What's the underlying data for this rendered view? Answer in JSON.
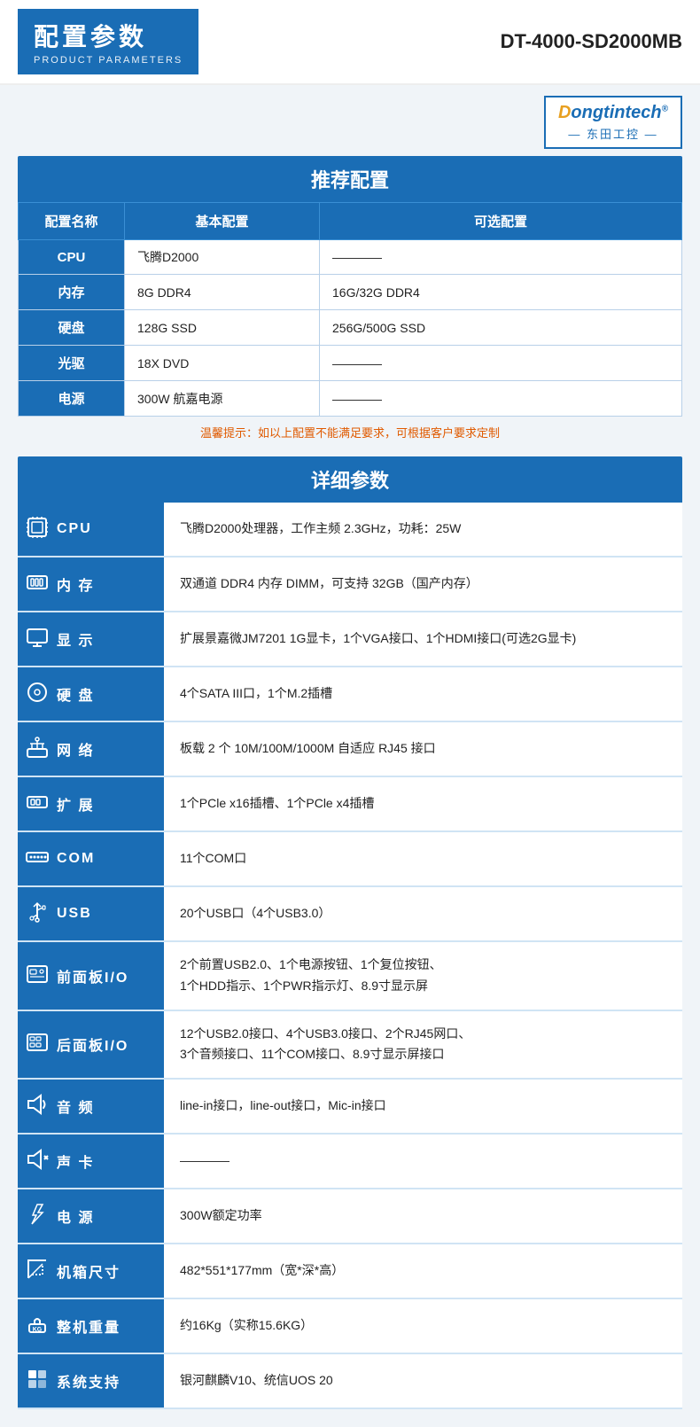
{
  "header": {
    "title_cn": "配置参数",
    "title_en": "PRODUCT PARAMETERS",
    "product_id": "DT-4000-SD2000MB"
  },
  "logo": {
    "brand_d": "D",
    "brand_rest": "ongtintech",
    "registered": "®",
    "sub": "— 东田工控 —"
  },
  "recommended": {
    "section_title": "推荐配置",
    "col_name": "配置名称",
    "col_basic": "基本配置",
    "col_optional": "可选配置",
    "rows": [
      {
        "label": "CPU",
        "basic": "飞腾D2000",
        "optional": "————"
      },
      {
        "label": "内存",
        "basic": "8G DDR4",
        "optional": "16G/32G DDR4"
      },
      {
        "label": "硬盘",
        "basic": "128G SSD",
        "optional": "256G/500G SSD"
      },
      {
        "label": "光驱",
        "basic": "18X DVD",
        "optional": "————"
      },
      {
        "label": "电源",
        "basic": "300W 航嘉电源",
        "optional": "————"
      }
    ],
    "tip": "温馨提示：如以上配置不能满足要求，可根据客户要求定制"
  },
  "detail": {
    "section_title": "详细参数",
    "rows": [
      {
        "icon": "🖥",
        "label": "CPU",
        "value": "飞腾D2000处理器，工作主频 2.3GHz，功耗：25W"
      },
      {
        "icon": "🗃",
        "label": "内 存",
        "value": "双通道 DDR4 内存 DIMM，可支持 32GB（国产内存）"
      },
      {
        "icon": "⌨",
        "label": "显 示",
        "value": "扩展景嘉微JM7201 1G显卡，1个VGA接口、1个HDMI接口(可选2G显卡)"
      },
      {
        "icon": "💾",
        "label": "硬 盘",
        "value": "4个SATA III口，1个M.2插槽"
      },
      {
        "icon": "📋",
        "label": "网 络",
        "value": "板载 2 个 10M/100M/1000M 自适应 RJ45 接口"
      },
      {
        "icon": "🖨",
        "label": "扩 展",
        "value": "1个PCle x16插槽、1个PCle x4插槽"
      },
      {
        "icon": "⌨",
        "label": "COM",
        "value": "11个COM口"
      },
      {
        "icon": "🔌",
        "label": "USB",
        "value": "20个USB口（4个USB3.0）"
      },
      {
        "icon": "📁",
        "label": "前面板I/O",
        "value": "2个前置USB2.0、1个电源按钮、1个复位按钮、\n1个HDD指示、1个PWR指示灯、8.9寸显示屏"
      },
      {
        "icon": "📁",
        "label": "后面板I/O",
        "value": "12个USB2.0接口、4个USB3.0接口、2个RJ45网口、\n3个音频接口、11个COM接口、8.9寸显示屏接口"
      },
      {
        "icon": "🔊",
        "label": "音 频",
        "value": "line-in接口，line-out接口，Mic-in接口"
      },
      {
        "icon": "🔊",
        "label": "声 卡",
        "value": "————"
      },
      {
        "icon": "⚡",
        "label": "电 源",
        "value": "300W额定功率"
      },
      {
        "icon": "📐",
        "label": "机箱尺寸",
        "value": "482*551*177mm（宽*深*高）"
      },
      {
        "icon": "⚖",
        "label": "整机重量",
        "value": "约16Kg（实称15.6KG）"
      },
      {
        "icon": "🪟",
        "label": "系统支持",
        "value": "银河麒麟V10、统信UOS 20"
      }
    ]
  }
}
